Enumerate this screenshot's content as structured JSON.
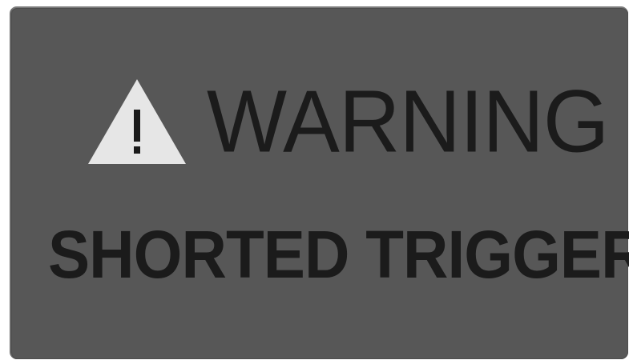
{
  "warning": {
    "icon": "warning-triangle-icon",
    "title": "WARNING",
    "message": "SHORTED TRIGGER"
  },
  "colors": {
    "panel_background": "#575757",
    "text": "#1b1b1b",
    "icon_fill": "#e6e6e6",
    "icon_mark": "#1b1b1b"
  }
}
